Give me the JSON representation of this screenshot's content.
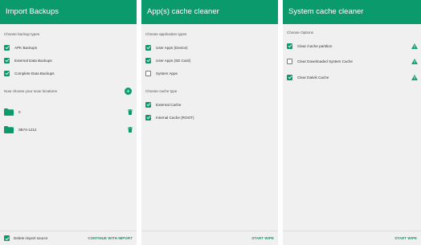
{
  "import_panel": {
    "title": "Import Backups",
    "types_header": "Choose backup types",
    "types": [
      {
        "label": "APK Backups",
        "checked": true
      },
      {
        "label": "External Data Backups",
        "checked": true
      },
      {
        "label": "Complete Data Backups",
        "checked": true
      }
    ],
    "locations_header": "Now choose your scan locations",
    "add_icon": "add-circle-icon",
    "locations": [
      {
        "label": "0",
        "icon": "folder-icon"
      },
      {
        "label": "0B74-1212",
        "icon": "folder-icon"
      }
    ],
    "delete_source_label": "Delete import source",
    "delete_source_checked": true,
    "continue_label": "CONTINUE WITH IMPORT"
  },
  "app_cache_panel": {
    "title": "App(s) cache cleaner",
    "app_types_header": "Choose application types",
    "app_types": [
      {
        "label": "User Apps (Device)",
        "checked": true
      },
      {
        "label": "User Apps (SD Card)",
        "checked": true
      },
      {
        "label": "System Apps",
        "checked": false
      }
    ],
    "cache_type_header": "Choose cache type",
    "cache_types": [
      {
        "label": "External Cache",
        "checked": true
      },
      {
        "label": "Internal Cache (ROOT)",
        "checked": true
      }
    ],
    "start_label": "START WIPE"
  },
  "system_cache_panel": {
    "title": "System cache cleaner",
    "options_header": "Choose Options",
    "options": [
      {
        "label": "Clear /cache partition",
        "checked": true,
        "warning": true
      },
      {
        "label": "Clear Downloaded System Cache",
        "checked": false,
        "warning": true
      },
      {
        "label": "Clear Dalvik Cache",
        "checked": true,
        "warning": true
      }
    ],
    "start_label": "START WIPE"
  },
  "colors": {
    "accent": "#0b9a6c",
    "warning": "#0b9a6c",
    "background": "#f0f0f0"
  }
}
